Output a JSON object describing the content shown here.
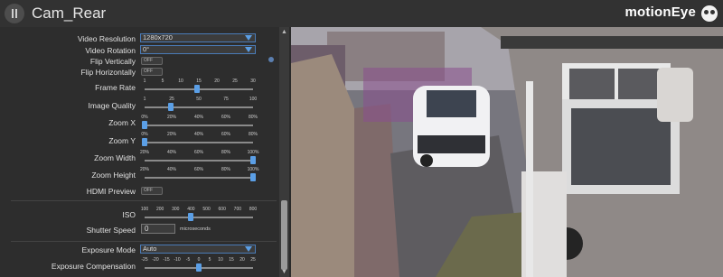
{
  "header": {
    "camera_name": "Cam_Rear",
    "brand": "motionEye"
  },
  "settings": {
    "video_resolution": {
      "label": "Video Resolution",
      "value": "1280x720"
    },
    "video_rotation": {
      "label": "Video Rotation",
      "value": "0°"
    },
    "flip_vertically": {
      "label": "Flip Vertically",
      "value": "OFF"
    },
    "flip_horizontally": {
      "label": "Flip Horizontally",
      "value": "OFF"
    },
    "frame_rate": {
      "label": "Frame Rate",
      "ticks": [
        "1",
        "5",
        "10",
        "15",
        "20",
        "25",
        "30"
      ],
      "value": 15,
      "min": 1,
      "max": 30
    },
    "image_quality": {
      "label": "Image Quality",
      "ticks": [
        "1",
        "25",
        "50",
        "75",
        "100"
      ],
      "value": 25,
      "min": 1,
      "max": 100
    },
    "zoom_x": {
      "label": "Zoom X",
      "ticks": [
        "0%",
        "20%",
        "40%",
        "60%",
        "80%"
      ],
      "value": 0,
      "min": 0,
      "max": 100
    },
    "zoom_y": {
      "label": "Zoom Y",
      "ticks": [
        "0%",
        "20%",
        "40%",
        "60%",
        "80%"
      ],
      "value": 0,
      "min": 0,
      "max": 100
    },
    "zoom_width": {
      "label": "Zoom Width",
      "ticks": [
        "20%",
        "40%",
        "60%",
        "80%",
        "100%"
      ],
      "value": 100,
      "min": 20,
      "max": 100
    },
    "zoom_height": {
      "label": "Zoom Height",
      "ticks": [
        "20%",
        "40%",
        "60%",
        "80%",
        "100%"
      ],
      "value": 100,
      "min": 20,
      "max": 100
    },
    "hdmi_preview": {
      "label": "HDMI Preview",
      "value": "OFF"
    },
    "iso": {
      "label": "ISO",
      "ticks": [
        "100",
        "200",
        "300",
        "400",
        "500",
        "600",
        "700",
        "800"
      ],
      "value": 400,
      "min": 100,
      "max": 800
    },
    "shutter_speed": {
      "label": "Shutter Speed",
      "value": "0",
      "unit": "microseconds"
    },
    "exposure_mode": {
      "label": "Exposure Mode",
      "value": "Auto"
    },
    "exposure_compensation": {
      "label": "Exposure Compensation",
      "ticks": [
        "-25",
        "-20",
        "-15",
        "-10",
        "-5",
        "0",
        "5",
        "10",
        "15",
        "20",
        "25"
      ],
      "value": 0,
      "min": -25,
      "max": 25
    }
  },
  "colors": {
    "accent": "#5b9fe6",
    "background": "#2d2d2d",
    "topbar": "#323232"
  },
  "icons": {
    "menu": "menu-icon",
    "logo": "owl-logo-icon",
    "help": "help-icon"
  }
}
